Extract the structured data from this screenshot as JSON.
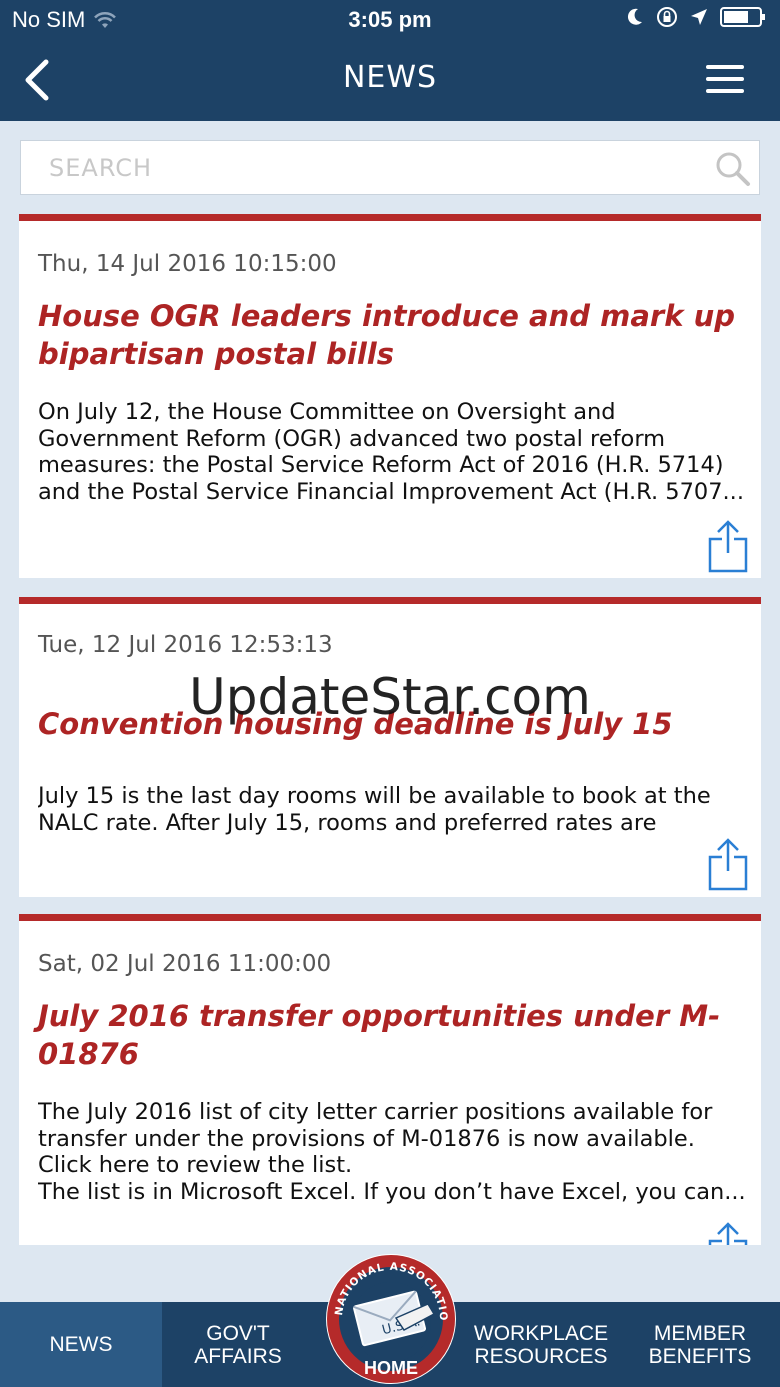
{
  "status": {
    "carrier": "No SIM",
    "time": "3:05 pm"
  },
  "nav": {
    "title": "NEWS"
  },
  "search": {
    "placeholder": "SEARCH"
  },
  "articles": [
    {
      "date": "Thu, 14 Jul 2016 10:15:00",
      "headline": "House OGR leaders introduce and mark up bipartisan postal bills",
      "body": "On July 12, the House Committee on Oversight and\nGovernment Reform (OGR) advanced two postal reform\nmeasures: the Postal Service Reform Act of 2016 (H.R. 5714)\nand the Postal Service Financial Improvement Act (H.R. 5707..."
    },
    {
      "date": "Tue, 12 Jul 2016 12:53:13",
      "headline": "Convention housing deadline is July 15",
      "body": "July 15 is the last day rooms will be available to book at the\nNALC rate. After July 15, rooms and preferred rates are based..."
    },
    {
      "date": "Sat, 02 Jul 2016 11:00:00",
      "headline": "July 2016 transfer opportunities under M-01876",
      "body": "The July 2016 list of city letter carrier positions available for\ntransfer under the provisions of M-01876 is now available.\nClick here to review the list.\nThe list is in Microsoft Excel. If you don’t have Excel, you can..."
    }
  ],
  "watermark": "UpdateStar.com",
  "tabs": [
    {
      "label": "NEWS"
    },
    {
      "label": "GOV'T\nAFFAIRS"
    },
    {
      "label": "HOME"
    },
    {
      "label": "WORKPLACE\nRESOURCES"
    },
    {
      "label": "MEMBER\nBENEFITS"
    }
  ],
  "seal_text": "NATIONAL ASSOCIATION OF LETTER CARRIERS",
  "seal_center": "U.S.A.",
  "colors": {
    "navy": "#1d4266",
    "accent_red": "#b52a2a",
    "share_blue": "#2a7fd4"
  }
}
